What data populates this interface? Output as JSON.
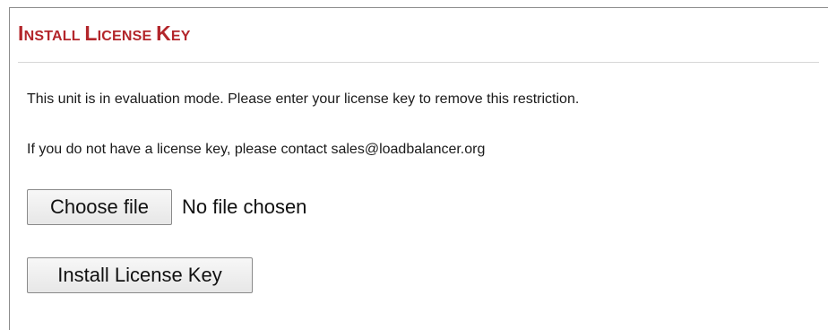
{
  "section": {
    "title_words": [
      {
        "first": "I",
        "rest": "NSTALL"
      },
      {
        "first": "L",
        "rest": "ICENSE"
      },
      {
        "first": "K",
        "rest": "EY"
      }
    ]
  },
  "messages": {
    "evaluation": "This unit is in evaluation mode. Please enter your license key to remove this restriction.",
    "contact_prefix": "If you do not have a license key, please contact ",
    "contact_email": "sales@loadbalancer.org"
  },
  "file_input": {
    "button_label": "Choose file",
    "status": "No file chosen"
  },
  "actions": {
    "install_label": "Install License Key"
  },
  "colors": {
    "title": "#b3262b",
    "text": "#1a1a1a"
  }
}
